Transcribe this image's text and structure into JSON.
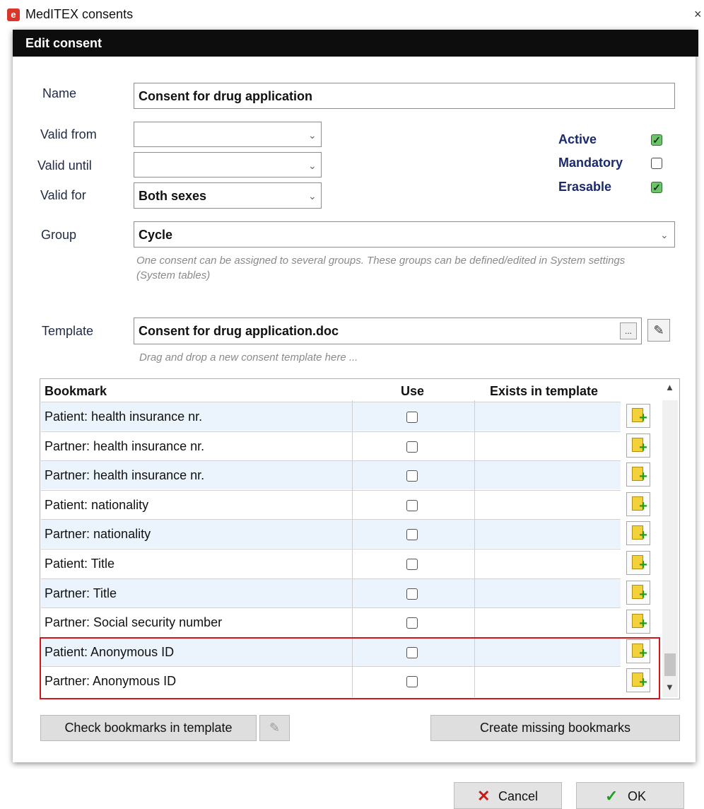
{
  "window": {
    "title": "MedITEX consents",
    "icon": "meditex-app-icon",
    "close_glyph": "×"
  },
  "dialog": {
    "title": "Edit consent"
  },
  "form": {
    "name_label": "Name",
    "name_value": "Consent for drug application",
    "valid_from_label": "Valid from",
    "valid_from_value": "",
    "valid_until_label": "Valid until",
    "valid_until_value": "",
    "valid_for_label": "Valid for",
    "valid_for_value": "Both sexes",
    "group_label": "Group",
    "group_value": "Cycle",
    "group_hint": "One consent can be assigned to several groups. These groups can be defined/edited in System settings (System tables)",
    "template_label": "Template",
    "template_value": "Consent for drug application.doc",
    "template_hint": "Drag and drop a new consent template here ...",
    "browse_label": "..."
  },
  "flags": [
    {
      "label": "Active",
      "checked": true
    },
    {
      "label": "Mandatory",
      "checked": false
    },
    {
      "label": "Erasable",
      "checked": true
    }
  ],
  "table": {
    "columns": [
      "Bookmark",
      "Use",
      "Exists in template"
    ],
    "rows": [
      {
        "bookmark": "Patient: health insurance nr.",
        "use": false
      },
      {
        "bookmark": "Partner: health insurance nr.",
        "use": false
      },
      {
        "bookmark": "Partner: health insurance nr.",
        "use": false
      },
      {
        "bookmark": "Patient: nationality",
        "use": false
      },
      {
        "bookmark": "Partner: nationality",
        "use": false
      },
      {
        "bookmark": "Patient: Title",
        "use": false
      },
      {
        "bookmark": "Partner: Title",
        "use": false
      },
      {
        "bookmark": "Partner: Social security number",
        "use": false
      },
      {
        "bookmark": "Patient: Anonymous ID",
        "use": false
      },
      {
        "bookmark": "Partner: Anonymous ID",
        "use": false
      }
    ]
  },
  "buttons": {
    "check_bookmarks": "Check bookmarks in template",
    "create_missing": "Create missing bookmarks",
    "cancel": "Cancel",
    "ok": "OK"
  },
  "colors": {
    "highlight": "#d4161b",
    "header": "#0d0d0d",
    "row_alt": "#ebf3fc",
    "flag_text": "#1b2a6b"
  }
}
